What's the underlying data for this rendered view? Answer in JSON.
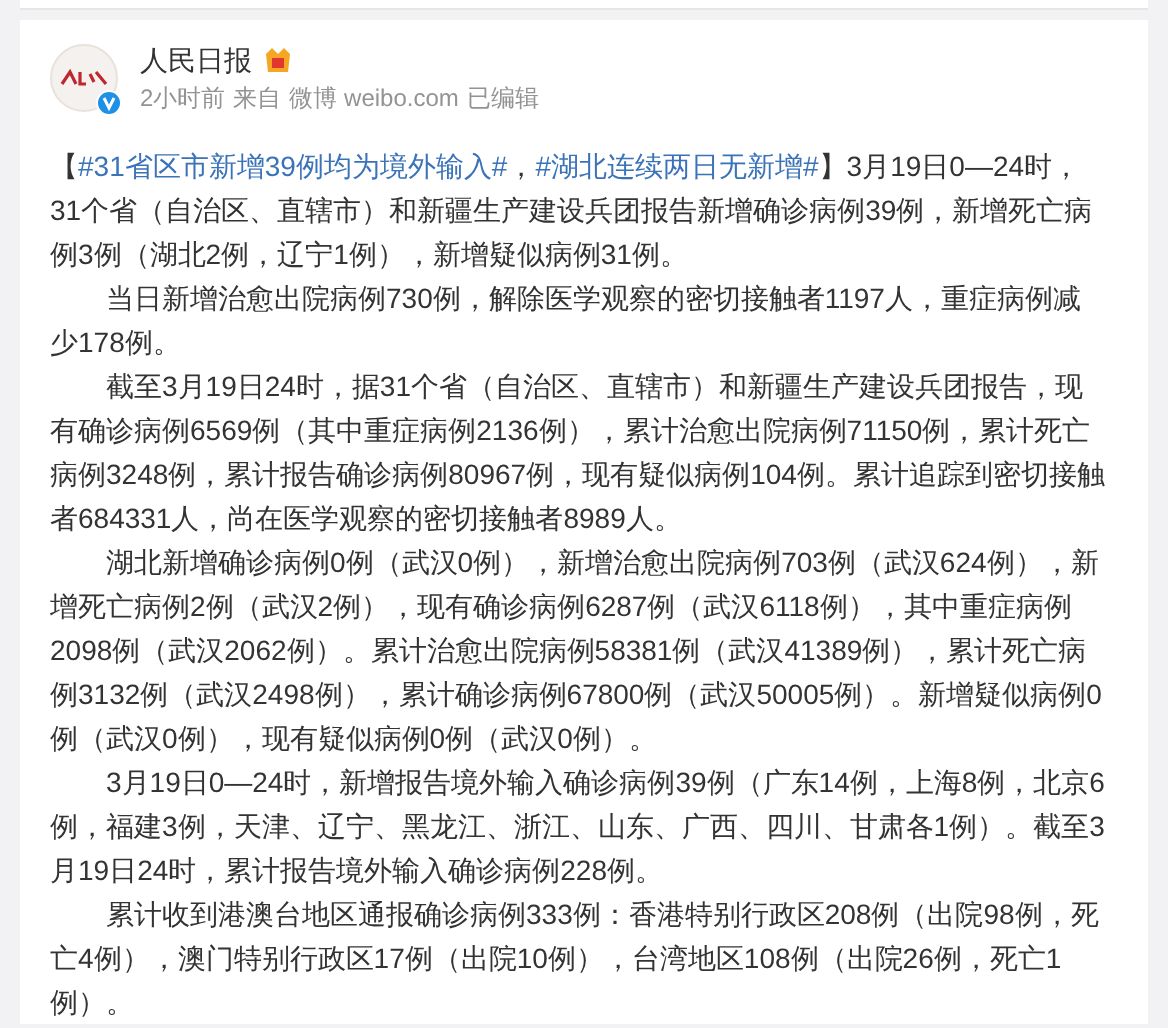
{
  "post": {
    "author": {
      "name": "人民日报",
      "verified": true,
      "member_badge": true
    },
    "meta": {
      "time": "2小时前",
      "source_prefix": "来自",
      "source": "微博 weibo.com",
      "edited": "已编辑"
    },
    "lead": [
      {
        "kind": "text",
        "text": "【"
      },
      {
        "kind": "hashtag",
        "text": "#31省区市新增39例均为境外输入#"
      },
      {
        "kind": "text",
        "text": "，"
      },
      {
        "kind": "hashtag",
        "text": "#湖北连续两日无新增#"
      },
      {
        "kind": "text",
        "text": "】3月19日0—24时，31个省（自治区、直辖市）和新疆生产建设兵团报告新增确诊病例39例，新增死亡病例3例（湖北2例，辽宁1例），新增疑似病例31例。"
      }
    ],
    "paragraphs": [
      "当日新增治愈出院病例730例，解除医学观察的密切接触者1197人，重症病例减少178例。",
      "截至3月19日24时，据31个省（自治区、直辖市）和新疆生产建设兵团报告，现有确诊病例6569例（其中重症病例2136例），累计治愈出院病例71150例，累计死亡病例3248例，累计报告确诊病例80967例，现有疑似病例104例。累计追踪到密切接触者684331人，尚在医学观察的密切接触者8989人。",
      "湖北新增确诊病例0例（武汉0例），新增治愈出院病例703例（武汉624例），新增死亡病例2例（武汉2例），现有确诊病例6287例（武汉6118例），其中重症病例2098例（武汉2062例）。累计治愈出院病例58381例（武汉41389例），累计死亡病例3132例（武汉2498例），累计确诊病例67800例（武汉50005例）。新增疑似病例0例（武汉0例），现有疑似病例0例（武汉0例）。",
      "3月19日0—24时，新增报告境外输入确诊病例39例（广东14例，上海8例，北京6例，福建3例，天津、辽宁、黑龙江、浙江、山东、广西、四川、甘肃各1例）。截至3月19日24时，累计报告境外输入确诊病例228例。",
      "累计收到港澳台地区通报确诊病例333例：香港特别行政区208例（出院98例，死亡4例），澳门特别行政区17例（出院10例），台湾地区108例（出院26例，死亡1例）。"
    ]
  }
}
